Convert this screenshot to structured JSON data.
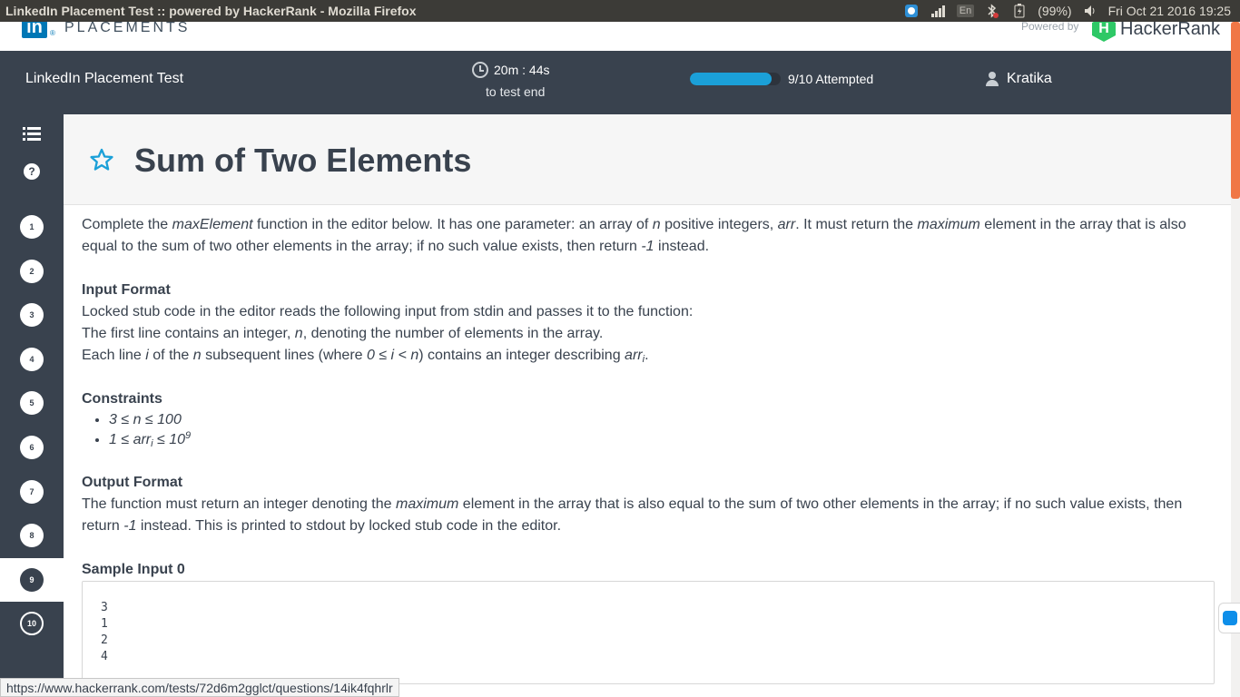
{
  "window": {
    "title": "LinkedIn Placement Test :: powered by HackerRank - Mozilla Firefox"
  },
  "tray": {
    "language": "En",
    "battery": "(99%)",
    "datetime": "Fri Oct 21 2016 19:25"
  },
  "brand": {
    "linkedin_logo": "in",
    "placements": "PLACEMENTS",
    "powered_by": "Powered by",
    "hackerrank_logo": "H",
    "hackerrank_name": "HackerRank"
  },
  "header": {
    "test_name": "LinkedIn Placement Test",
    "timer": "20m : 44s",
    "timer_sub": "to test end",
    "progress_fraction": 0.9,
    "attempted": "9/10 Attempted",
    "user": "Kratika"
  },
  "sidebar": {
    "help": "?",
    "questions": [
      {
        "label": "1",
        "state": "done"
      },
      {
        "label": "2",
        "state": "done"
      },
      {
        "label": "3",
        "state": "done"
      },
      {
        "label": "4",
        "state": "done"
      },
      {
        "label": "5",
        "state": "done"
      },
      {
        "label": "6",
        "state": "done"
      },
      {
        "label": "7",
        "state": "done"
      },
      {
        "label": "8",
        "state": "done"
      },
      {
        "label": "9",
        "state": "active"
      },
      {
        "label": "10",
        "state": "pending"
      }
    ]
  },
  "question": {
    "title": "Sum of Two Elements",
    "intro": {
      "p1": "Complete the ",
      "fn": "maxElement",
      "p2": " function in the editor below. It has one parameter: an array of ",
      "n": "n",
      "p3": " positive integers, ",
      "arr": "arr",
      "p4": ". It must return the ",
      "maximum": "maximum",
      "p5": " element in the array that is also equal to the sum of two other elements in the array; if no such value exists, then return ",
      "neg1": "-1",
      "p6": " instead."
    },
    "input_format": {
      "heading": "Input Format",
      "line1": "Locked stub code in the editor reads the following input from stdin and passes it to the function:",
      "line2a": "The first line contains an integer, ",
      "line2n": "n",
      "line2b": ", denoting the number of elements in the array.",
      "line3a": "Each line ",
      "line3i": "i",
      "line3b": " of the ",
      "line3n": "n",
      "line3c": " subsequent lines (where ",
      "line3cond": "0 ≤ i < n",
      "line3d": ") contains an integer describing ",
      "line3arr": "arr",
      "line3sub": "i",
      "line3e": "."
    },
    "constraints": {
      "heading": "Constraints",
      "c1": "3 ≤ n ≤ 100",
      "c2a": "1 ≤ arr",
      "c2sub": "i",
      "c2b": " ≤ 10",
      "c2sup": "9"
    },
    "output_format": {
      "heading": "Output Format",
      "p1": "The function must return an integer denoting the ",
      "maximum": "maximum",
      "p2": " element in the array that is also equal to the sum of two other elements in the array; if no such value exists, then return ",
      "neg1": "-1",
      "p3": " instead. This is printed to stdout by locked stub code in the editor."
    },
    "sample_input": {
      "heading": "Sample Input 0",
      "lines": [
        "3",
        "1",
        "2",
        "4"
      ]
    }
  },
  "status_url": "https://www.hackerrank.com/tests/72d6m2gglct/questions/14ik4fqhrlr",
  "colors": {
    "header_bg": "#39424e",
    "progress": "#1ba0d8",
    "accent_star": "#1ba0d8",
    "scroll_thumb": "#f07746"
  }
}
